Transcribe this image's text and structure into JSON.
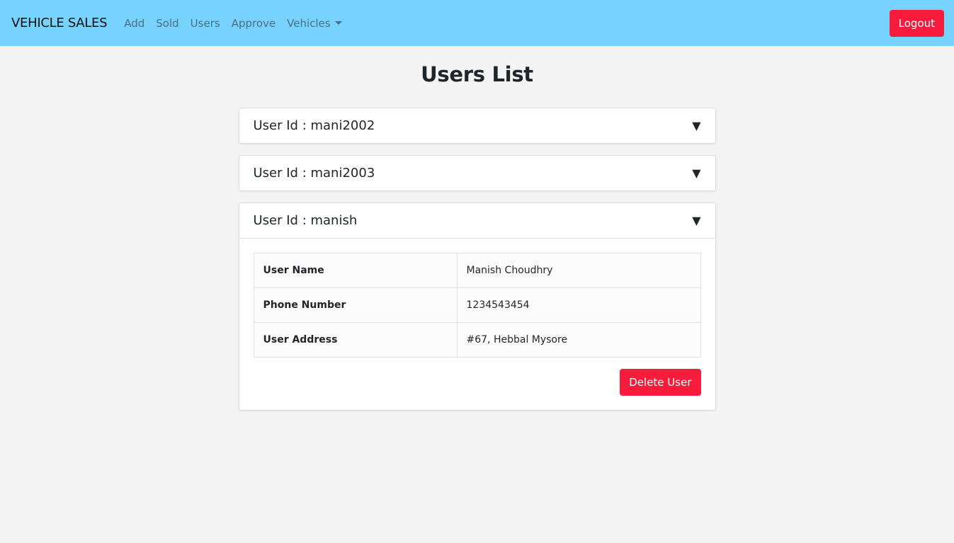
{
  "nav": {
    "brand": "VEHICLE SALES",
    "links": [
      "Add",
      "Sold",
      "Users",
      "Approve"
    ],
    "dropdown": "Vehicles",
    "logout": "Logout"
  },
  "page": {
    "title": "Users List"
  },
  "users": [
    {
      "id_label": "User Id : mani2002",
      "expanded": false
    },
    {
      "id_label": "User Id : mani2003",
      "expanded": false
    },
    {
      "id_label": "User Id : manish",
      "expanded": true,
      "details": [
        {
          "k": "User Name",
          "v": "Manish Choudhry"
        },
        {
          "k": "Phone Number",
          "v": "1234543454"
        },
        {
          "k": "User Address",
          "v": "#67, Hebbal Mysore"
        }
      ],
      "delete_label": "Delete User"
    }
  ],
  "icons": {
    "toggle": "triangle-down-icon"
  },
  "colors": {
    "navbar": "#77d2ff",
    "danger": "#f71b3c"
  }
}
